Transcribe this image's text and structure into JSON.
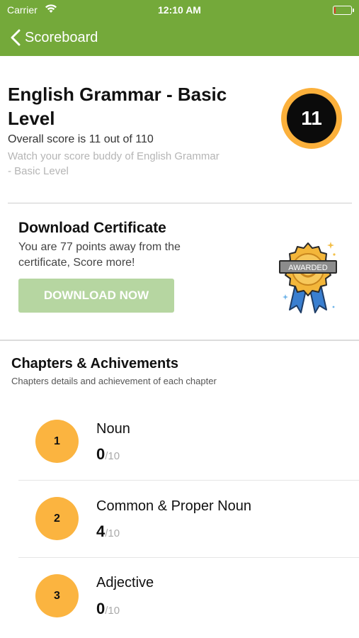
{
  "status_bar": {
    "carrier": "Carrier",
    "time": "12:10 AM",
    "battery_color": "#e03b2f"
  },
  "nav": {
    "back_label": "Scoreboard",
    "bar_color": "#74a93a"
  },
  "header": {
    "title": "English Grammar - Basic Level",
    "overall_score_text": "Overall score is 11 out of 110",
    "watch_text": "Watch your score buddy of English Grammar - Basic Level",
    "score": "11",
    "score_ring_color": "#fbb03b"
  },
  "certificate": {
    "title": "Download Certificate",
    "description": "You are 77 points away from the certificate, Score more!",
    "button_label": "DOWNLOAD NOW",
    "button_color": "#b6d6a1",
    "badge_text": "AWARDED",
    "badge_icon": "award-ribbon-icon"
  },
  "chapters": {
    "title": "Chapters & Achivements",
    "subtitle": "Chapters details and achievement of each chapter",
    "circle_color": "#fbb440",
    "items": [
      {
        "number": "1",
        "name": "Noun",
        "score": "0",
        "max": "/10"
      },
      {
        "number": "2",
        "name": "Common & Proper Noun",
        "score": "4",
        "max": "/10"
      },
      {
        "number": "3",
        "name": "Adjective",
        "score": "0",
        "max": "/10"
      }
    ]
  }
}
